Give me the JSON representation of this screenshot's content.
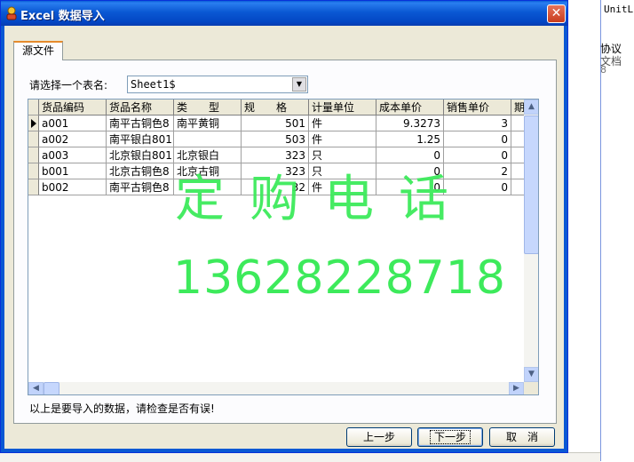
{
  "background": {
    "right_text_1": "UnitLi",
    "right_text_2": "协议",
    "right_text_3": "文档",
    "right_text_4": "8"
  },
  "window": {
    "title": "Excel 数据导入",
    "close_glyph": "✕"
  },
  "tab": {
    "label": "源文件"
  },
  "sheet": {
    "label": "请选择一个表名:",
    "selected": "Sheet1$"
  },
  "grid": {
    "columns": [
      "货品编码",
      "货品名称",
      "类　　型",
      "规　　格",
      "计量单位",
      "成本单价",
      "销售单价",
      "期"
    ],
    "rows": [
      [
        "a001",
        "南平古铜色8",
        "南平黄铜",
        "501",
        "件",
        "9.3273",
        "3",
        ""
      ],
      [
        "a002",
        "南平银白801",
        "",
        "503",
        "件",
        "1.25",
        "0",
        ""
      ],
      [
        "a003",
        "北京银白801",
        "北京银白",
        "323",
        "只",
        "0",
        "0",
        ""
      ],
      [
        "b001",
        "北京古铜色8",
        "北京古铜",
        "323",
        "只",
        "0",
        "2",
        ""
      ],
      [
        "b002",
        "南平古铜色8",
        "",
        "32",
        "件",
        "0",
        "0",
        ""
      ]
    ]
  },
  "watermark": {
    "line1": "定购电话",
    "line2": "13628228718"
  },
  "status": "以上是要导入的数据，请检查是否有误!",
  "buttons": {
    "prev": "上一步",
    "next": "下一步",
    "cancel": "取　消"
  },
  "colors": {
    "title_bar": "#0a58d3",
    "watermark": "#3dea5b"
  }
}
